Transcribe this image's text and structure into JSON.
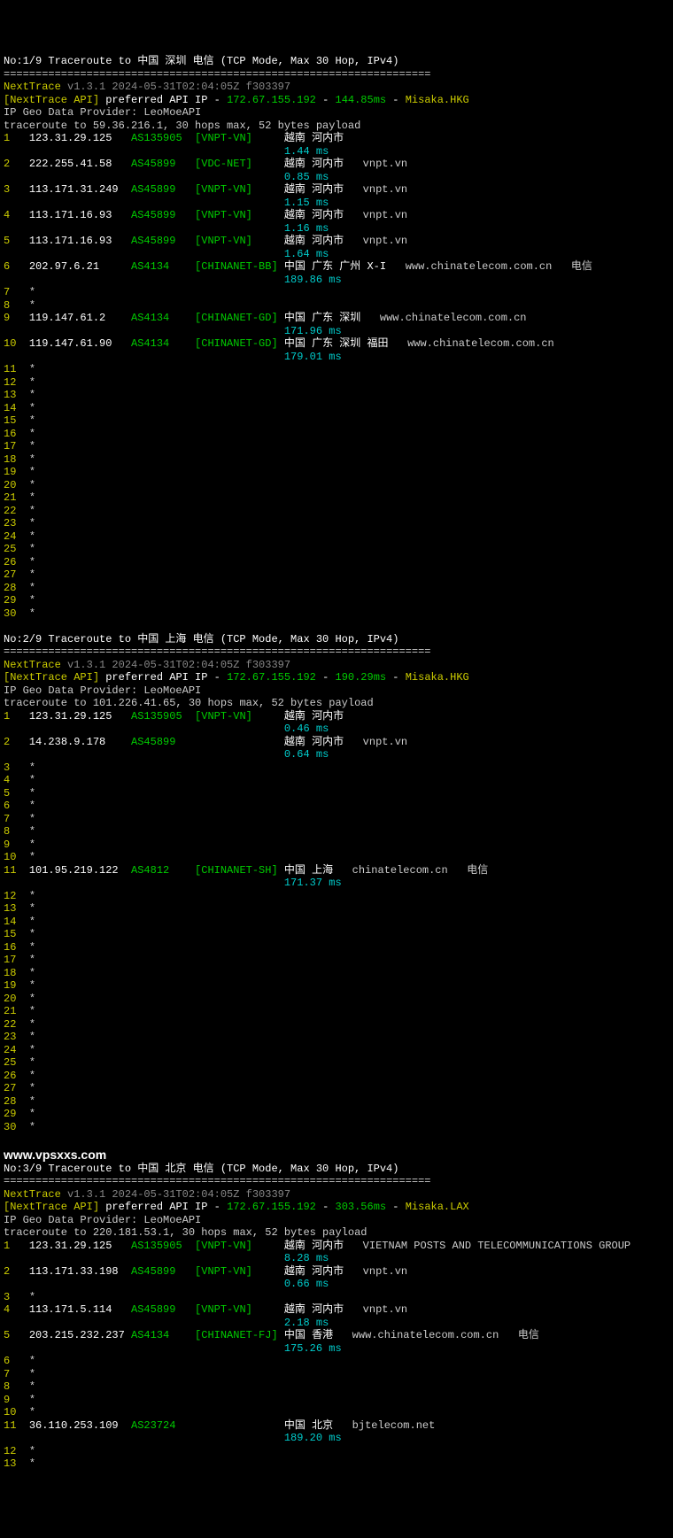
{
  "sep": "===================================================================",
  "api_label": "[NextTrace API]",
  "api_text": " preferred API IP - ",
  "geo": "IP Geo Data Provider: LeoMoeAPI",
  "nt": "NextTrace",
  "ver": " v1.3.1 2024-05-31T02:04:05Z f303397",
  "wm": "www.vpsxxs.com",
  "t1": {
    "title": "No:1/9 Traceroute to 中国 深圳 电信 (TCP Mode, Max 30 Hop, IPv4)",
    "api_ip": "172.67.155.192",
    "api_lat": "144.85ms",
    "api_loc": "Misaka.HKG",
    "tr": "traceroute to 59.36.216.1, 30 hops max, 52 bytes payload",
    "hops": [
      {
        "n": "1",
        "ip": "123.31.29.125",
        "as": "AS135905",
        "net": "[VNPT-VN]",
        "loc": "越南 河内市",
        "host": "",
        "isp": "",
        "lat": "1.44 ms"
      },
      {
        "n": "2",
        "ip": "222.255.41.58",
        "as": "AS45899",
        "net": "[VDC-NET]",
        "loc": "越南 河内市",
        "host": "vnpt.vn",
        "isp": "",
        "lat": "0.85 ms"
      },
      {
        "n": "3",
        "ip": "113.171.31.249",
        "as": "AS45899",
        "net": "[VNPT-VN]",
        "loc": "越南 河内市",
        "host": "vnpt.vn",
        "isp": "",
        "lat": "1.15 ms"
      },
      {
        "n": "4",
        "ip": "113.171.16.93",
        "as": "AS45899",
        "net": "[VNPT-VN]",
        "loc": "越南 河内市",
        "host": "vnpt.vn",
        "isp": "",
        "lat": "1.16 ms"
      },
      {
        "n": "5",
        "ip": "113.171.16.93",
        "as": "AS45899",
        "net": "[VNPT-VN]",
        "loc": "越南 河内市",
        "host": "vnpt.vn",
        "isp": "",
        "lat": "1.64 ms"
      },
      {
        "n": "6",
        "ip": "202.97.6.21",
        "as": "AS4134",
        "net": "[CHINANET-BB]",
        "loc": "中国 广东 广州 X-I",
        "host": "www.chinatelecom.com.cn",
        "isp": "电信",
        "lat": "189.86 ms"
      },
      {
        "n": "7",
        "ip": "*"
      },
      {
        "n": "8",
        "ip": "*"
      },
      {
        "n": "9",
        "ip": "119.147.61.2",
        "as": "AS4134",
        "net": "[CHINANET-GD]",
        "loc": "中国 广东 深圳",
        "host": "www.chinatelecom.com.cn",
        "isp": "",
        "lat": "171.96 ms"
      },
      {
        "n": "10",
        "ip": "119.147.61.90",
        "as": "AS4134",
        "net": "[CHINANET-GD]",
        "loc": "中国 广东 深圳 福田",
        "host": "www.chinatelecom.com.cn",
        "isp": "",
        "lat": "179.01 ms"
      },
      {
        "n": "11",
        "ip": "*"
      },
      {
        "n": "12",
        "ip": "*"
      },
      {
        "n": "13",
        "ip": "*"
      },
      {
        "n": "14",
        "ip": "*"
      },
      {
        "n": "15",
        "ip": "*"
      },
      {
        "n": "16",
        "ip": "*"
      },
      {
        "n": "17",
        "ip": "*"
      },
      {
        "n": "18",
        "ip": "*"
      },
      {
        "n": "19",
        "ip": "*"
      },
      {
        "n": "20",
        "ip": "*"
      },
      {
        "n": "21",
        "ip": "*"
      },
      {
        "n": "22",
        "ip": "*"
      },
      {
        "n": "23",
        "ip": "*"
      },
      {
        "n": "24",
        "ip": "*"
      },
      {
        "n": "25",
        "ip": "*"
      },
      {
        "n": "26",
        "ip": "*"
      },
      {
        "n": "27",
        "ip": "*"
      },
      {
        "n": "28",
        "ip": "*"
      },
      {
        "n": "29",
        "ip": "*"
      },
      {
        "n": "30",
        "ip": "*"
      }
    ]
  },
  "t2": {
    "title": "No:2/9 Traceroute to 中国 上海 电信 (TCP Mode, Max 30 Hop, IPv4)",
    "api_ip": "172.67.155.192",
    "api_lat": "190.29ms",
    "api_loc": "Misaka.HKG",
    "tr": "traceroute to 101.226.41.65, 30 hops max, 52 bytes payload",
    "hops": [
      {
        "n": "1",
        "ip": "123.31.29.125",
        "as": "AS135905",
        "net": "[VNPT-VN]",
        "loc": "越南 河内市",
        "host": "",
        "isp": "",
        "lat": "0.46 ms"
      },
      {
        "n": "2",
        "ip": "14.238.9.178",
        "as": "AS45899",
        "net": "",
        "loc": "越南 河内市",
        "host": "vnpt.vn",
        "isp": "",
        "lat": "0.64 ms"
      },
      {
        "n": "3",
        "ip": "*"
      },
      {
        "n": "4",
        "ip": "*"
      },
      {
        "n": "5",
        "ip": "*"
      },
      {
        "n": "6",
        "ip": "*"
      },
      {
        "n": "7",
        "ip": "*"
      },
      {
        "n": "8",
        "ip": "*"
      },
      {
        "n": "9",
        "ip": "*"
      },
      {
        "n": "10",
        "ip": "*"
      },
      {
        "n": "11",
        "ip": "101.95.219.122",
        "as": "AS4812",
        "net": "[CHINANET-SH]",
        "loc": "中国 上海",
        "host": "chinatelecom.cn",
        "isp": "电信",
        "lat": "171.37 ms"
      },
      {
        "n": "12",
        "ip": "*"
      },
      {
        "n": "13",
        "ip": "*"
      },
      {
        "n": "14",
        "ip": "*"
      },
      {
        "n": "15",
        "ip": "*"
      },
      {
        "n": "16",
        "ip": "*"
      },
      {
        "n": "17",
        "ip": "*"
      },
      {
        "n": "18",
        "ip": "*"
      },
      {
        "n": "19",
        "ip": "*"
      },
      {
        "n": "20",
        "ip": "*"
      },
      {
        "n": "21",
        "ip": "*"
      },
      {
        "n": "22",
        "ip": "*"
      },
      {
        "n": "23",
        "ip": "*"
      },
      {
        "n": "24",
        "ip": "*"
      },
      {
        "n": "25",
        "ip": "*"
      },
      {
        "n": "26",
        "ip": "*"
      },
      {
        "n": "27",
        "ip": "*"
      },
      {
        "n": "28",
        "ip": "*"
      },
      {
        "n": "29",
        "ip": "*"
      },
      {
        "n": "30",
        "ip": "*"
      }
    ]
  },
  "t3": {
    "title": "No:3/9 Traceroute to 中国 北京 电信 (TCP Mode, Max 30 Hop, IPv4)",
    "api_ip": "172.67.155.192",
    "api_lat": "303.56ms",
    "api_loc": "Misaka.LAX",
    "tr": "traceroute to 220.181.53.1, 30 hops max, 52 bytes payload",
    "hops": [
      {
        "n": "1",
        "ip": "123.31.29.125",
        "as": "AS135905",
        "net": "[VNPT-VN]",
        "loc": "越南 河内市",
        "host": "VIETNAM POSTS AND TELECOMMUNICATIONS GROUP",
        "isp": "",
        "lat": "8.28 ms"
      },
      {
        "n": "2",
        "ip": "113.171.33.198",
        "as": "AS45899",
        "net": "[VNPT-VN]",
        "loc": "越南 河内市",
        "host": "vnpt.vn",
        "isp": "",
        "lat": "0.66 ms"
      },
      {
        "n": "3",
        "ip": "*"
      },
      {
        "n": "4",
        "ip": "113.171.5.114",
        "as": "AS45899",
        "net": "[VNPT-VN]",
        "loc": "越南 河内市",
        "host": "vnpt.vn",
        "isp": "",
        "lat": "2.18 ms"
      },
      {
        "n": "5",
        "ip": "203.215.232.237",
        "as": "AS4134",
        "net": "[CHINANET-FJ]",
        "loc": "中国 香港",
        "host": "www.chinatelecom.com.cn",
        "isp": "电信",
        "lat": "175.26 ms"
      },
      {
        "n": "6",
        "ip": "*"
      },
      {
        "n": "7",
        "ip": "*"
      },
      {
        "n": "8",
        "ip": "*"
      },
      {
        "n": "9",
        "ip": "*"
      },
      {
        "n": "10",
        "ip": "*"
      },
      {
        "n": "11",
        "ip": "36.110.253.109",
        "as": "AS23724",
        "net": "",
        "loc": "中国 北京",
        "host": "bjtelecom.net",
        "isp": "",
        "lat": "189.20 ms"
      },
      {
        "n": "12",
        "ip": "*"
      },
      {
        "n": "13",
        "ip": "*"
      }
    ]
  }
}
